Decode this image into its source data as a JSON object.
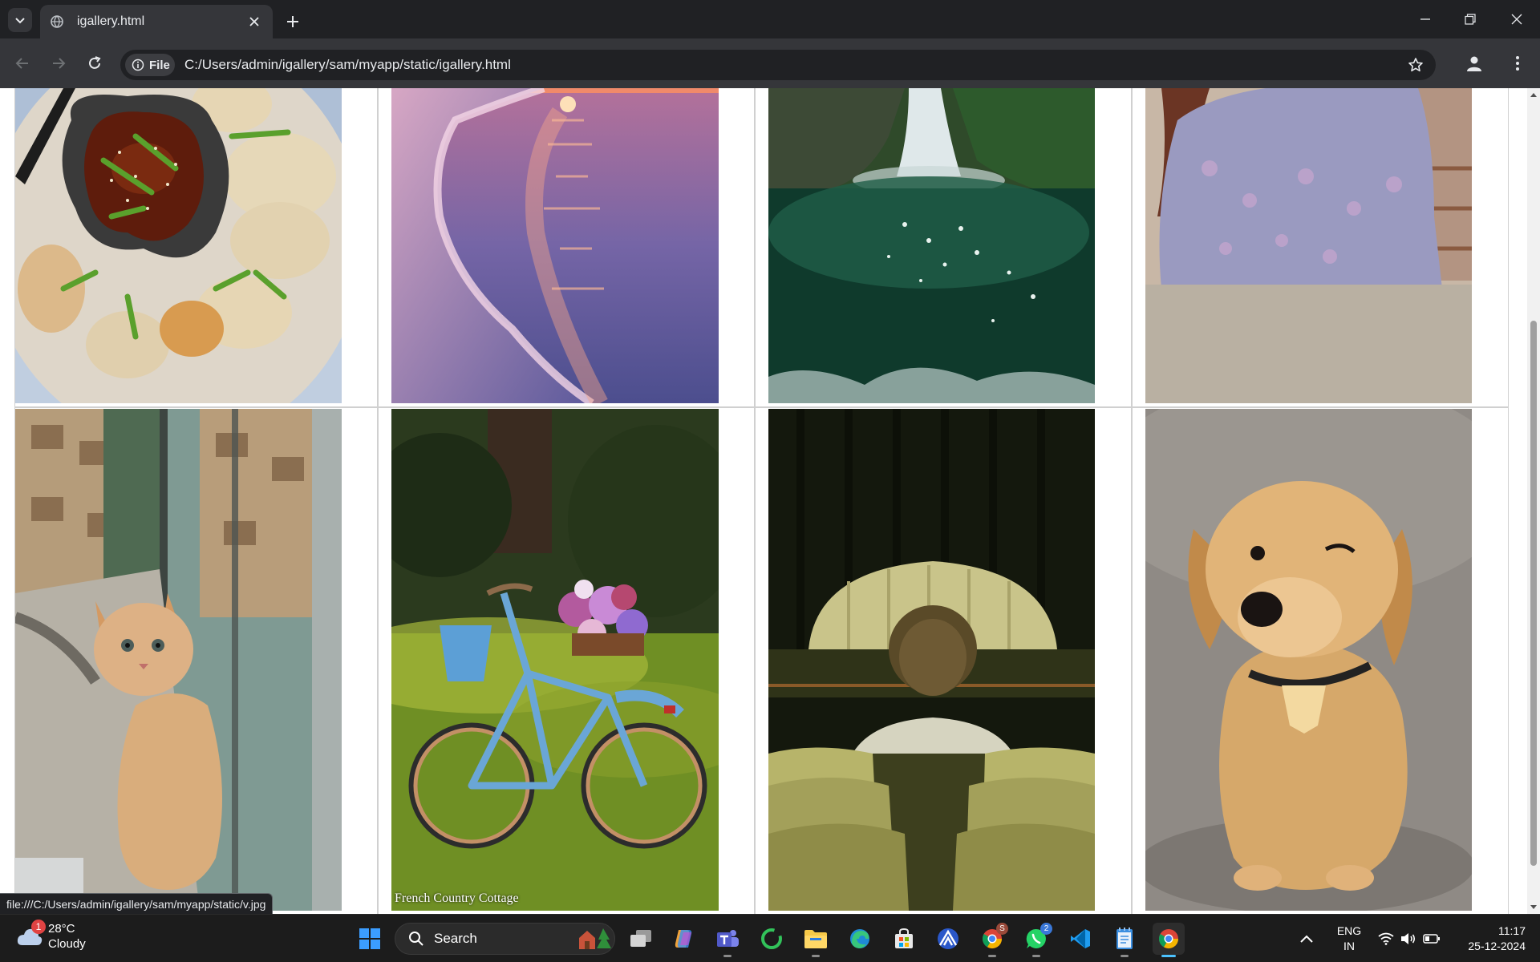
{
  "browser": {
    "tab_title": "igallery.html",
    "chip_label": "File",
    "url": "C:/Users/admin/igallery/sam/myapp/static/igallery.html",
    "status_url": "file:///C:/Users/admin/igallery/sam/myapp/static/v.jpg",
    "icons": [
      "tab-search-icon",
      "globe-icon",
      "close-icon",
      "plus-icon",
      "minimize-icon",
      "restore-icon",
      "close-window-icon",
      "back-arrow-icon",
      "forward-arrow-icon",
      "reload-icon",
      "info-icon",
      "star-icon",
      "profile-icon",
      "menu-dots-icon"
    ]
  },
  "gallery": {
    "images": [
      {
        "subject": "dumplings"
      },
      {
        "subject": "sunset-beach"
      },
      {
        "subject": "waterfall"
      },
      {
        "subject": "person-in-room"
      },
      {
        "subject": "kitten"
      },
      {
        "subject": "bicycle",
        "caption": "French Country Cottage"
      },
      {
        "subject": "theater"
      },
      {
        "subject": "puppy"
      }
    ]
  },
  "taskbar": {
    "weather": {
      "temp": "28°C",
      "condition": "Cloudy",
      "badge": "1"
    },
    "search_label": "Search",
    "apps": [
      {
        "name": "start"
      },
      {
        "name": "task-view"
      },
      {
        "name": "copilot"
      },
      {
        "name": "teams"
      },
      {
        "name": "app-green"
      },
      {
        "name": "file-explorer"
      },
      {
        "name": "edge"
      },
      {
        "name": "store"
      },
      {
        "name": "app-blue"
      },
      {
        "name": "chrome-profile",
        "badge": "S"
      },
      {
        "name": "whatsapp",
        "badge": "2"
      },
      {
        "name": "vscode"
      },
      {
        "name": "notepad"
      },
      {
        "name": "chrome"
      }
    ],
    "lang_line1": "ENG",
    "lang_line2": "IN",
    "time": "11:17",
    "date": "25-12-2024"
  },
  "colors": {
    "accent": "#4cc2ff",
    "chrome_bg": "#202124",
    "toolbar_bg": "#35363a"
  }
}
